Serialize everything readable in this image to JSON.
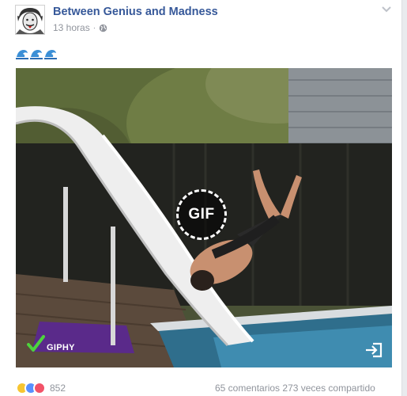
{
  "post": {
    "page_name": "Between Genius and Madness",
    "time": "13 horas",
    "separator": "·",
    "text_icons": [
      "wave-icon",
      "wave-icon",
      "wave-icon"
    ]
  },
  "media": {
    "badge_label": "GIF",
    "provider": "GIPHY"
  },
  "footer": {
    "reaction_count": "852",
    "comments": "65 comentarios",
    "shares": "273 veces compartido"
  },
  "colors": {
    "page_name": "#365899",
    "meta_text": "#90949c",
    "like": "#5890ff",
    "love": "#f25268",
    "haha": "#f7c531",
    "giphy_check": "#4dd33c"
  }
}
